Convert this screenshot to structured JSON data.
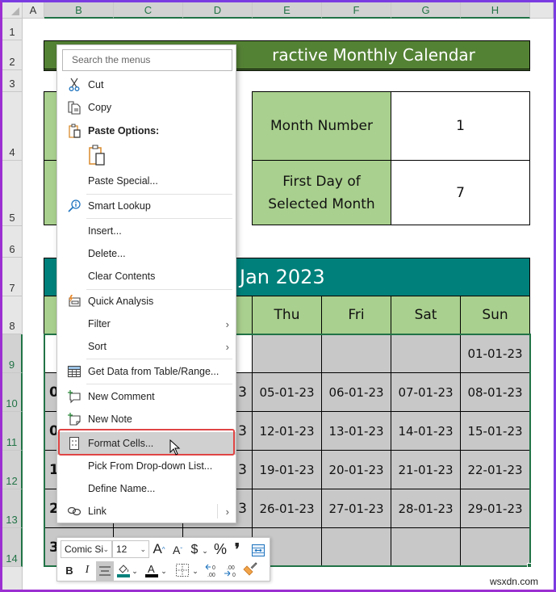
{
  "columns": [
    "A",
    "B",
    "C",
    "D",
    "E",
    "F",
    "G",
    "H"
  ],
  "rows": [
    "1",
    "2",
    "3",
    "4",
    "5",
    "6",
    "7",
    "8",
    "9",
    "10",
    "11",
    "12",
    "13",
    "14"
  ],
  "sheet": {
    "title": "Interactive Monthly Calendar",
    "title_visible": "ractive Monthly Calendar",
    "info": [
      {
        "label": "Month Number",
        "value": "1"
      },
      {
        "label_line1": "First Day of",
        "label_line2": "Selected Month",
        "value": "7"
      }
    ],
    "calendar_header": "Jan 2023",
    "weekdays_visible": [
      "Thu",
      "Fri",
      "Sat",
      "Sun"
    ],
    "date_rows": [
      {
        "left_partial": "",
        "mid_partial": "",
        "cells": [
          "",
          "",
          "",
          "01-01-23"
        ]
      },
      {
        "left_partial": "0",
        "mid_partial": "3",
        "cells": [
          "05-01-23",
          "06-01-23",
          "07-01-23",
          "08-01-23"
        ]
      },
      {
        "left_partial": "0",
        "mid_partial": "3",
        "cells": [
          "12-01-23",
          "13-01-23",
          "14-01-23",
          "15-01-23"
        ]
      },
      {
        "left_partial": "1",
        "mid_partial": "3",
        "cells": [
          "19-01-23",
          "20-01-23",
          "21-01-23",
          "22-01-23"
        ]
      },
      {
        "left_partial": "2",
        "mid_partial": "3",
        "cells": [
          "26-01-23",
          "27-01-23",
          "28-01-23",
          "29-01-23"
        ]
      },
      {
        "left_partial": "3",
        "mid_partial": "",
        "cells": [
          "",
          "",
          "",
          ""
        ]
      }
    ],
    "colors": {
      "title_green": "#548235",
      "light_green": "#a9d08e",
      "teal": "#00807a",
      "date_gray": "#c8c8c8",
      "selection_green": "#217346"
    }
  },
  "context_menu": {
    "search_placeholder": "Search the menus",
    "items": [
      {
        "id": "cut",
        "label": "Cut",
        "icon": "scissors-icon"
      },
      {
        "id": "copy",
        "label": "Copy",
        "icon": "copy-icon"
      },
      {
        "id": "paste-options",
        "label": "Paste Options:",
        "icon": "clipboard-icon"
      },
      {
        "id": "paste-special",
        "label": "Paste Special..."
      },
      {
        "id": "smart-lookup",
        "label": "Smart Lookup",
        "icon": "search-info-icon"
      },
      {
        "id": "insert",
        "label": "Insert..."
      },
      {
        "id": "delete",
        "label": "Delete..."
      },
      {
        "id": "clear-contents",
        "label": "Clear Contents"
      },
      {
        "id": "quick-analysis",
        "label": "Quick Analysis",
        "icon": "quick-analysis-icon"
      },
      {
        "id": "filter",
        "label": "Filter",
        "submenu": true
      },
      {
        "id": "sort",
        "label": "Sort",
        "submenu": true
      },
      {
        "id": "get-data",
        "label": "Get Data from Table/Range...",
        "icon": "table-icon"
      },
      {
        "id": "new-comment",
        "label": "New Comment",
        "icon": "new-comment-icon"
      },
      {
        "id": "new-note",
        "label": "New Note",
        "icon": "new-note-icon"
      },
      {
        "id": "format-cells",
        "label": "Format Cells...",
        "icon": "format-cells-icon",
        "highlighted": true
      },
      {
        "id": "pick-list",
        "label": "Pick From Drop-down List..."
      },
      {
        "id": "define-name",
        "label": "Define Name..."
      },
      {
        "id": "link",
        "label": "Link",
        "icon": "link-icon",
        "submenu": true
      }
    ]
  },
  "mini_toolbar": {
    "font_name": "Comic Si",
    "font_size": "12",
    "grow_font": "A",
    "shrink_font": "A",
    "currency": "$",
    "percent": "%",
    "comma": "❜",
    "bold": "B",
    "italic": "I",
    "font_color_letter": "A"
  },
  "watermark": "wsxdn.com"
}
